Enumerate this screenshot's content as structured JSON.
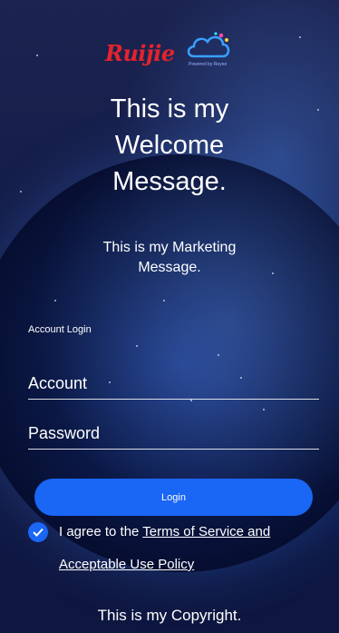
{
  "logo": {
    "brand": "Ruijie",
    "tagline": "Powered by Reyee"
  },
  "welcome_message": "This is my Welcome Message.",
  "marketing_message": "This is my Marketing Message.",
  "login_form": {
    "section_label": "Account Login",
    "account_placeholder": "Account",
    "password_placeholder": "Password",
    "login_label": "Login"
  },
  "agreement": {
    "checked": true,
    "prefix": "I agree to the ",
    "link_part1": "Terms of Service and",
    "link_part2": "Acceptable Use Policy"
  },
  "copyright": "This is my Copyright.",
  "colors": {
    "accent": "#1a66f5",
    "brand_red": "#e4232d",
    "background": "#131c47",
    "text": "#ffffff"
  }
}
